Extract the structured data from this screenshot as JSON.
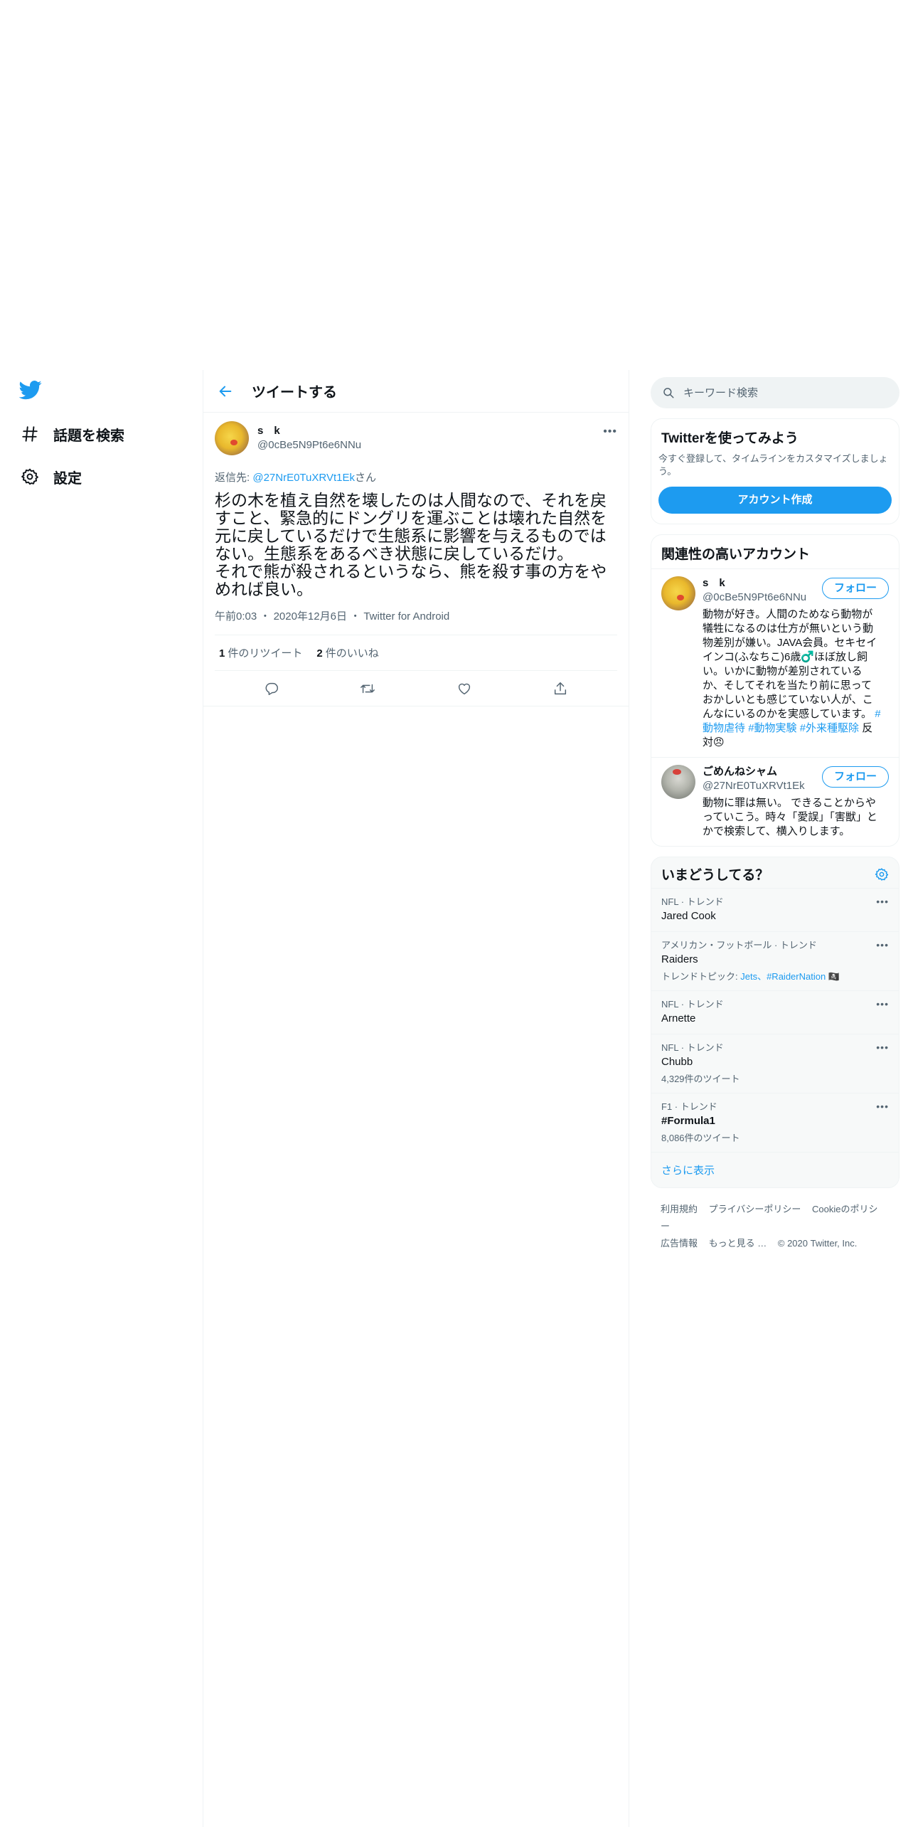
{
  "nav": {
    "items": [
      {
        "label": "話題を検索",
        "icon": "hashtag-icon"
      },
      {
        "label": "設定",
        "icon": "gear-icon"
      }
    ]
  },
  "header": {
    "title": "ツイートする"
  },
  "tweet": {
    "author_name": "s　k",
    "author_handle": "@0cBe5N9Pt6e6NNu",
    "replying_prefix": "返信先: ",
    "replying_to": "@27NrE0TuXRVt1Ek",
    "replying_suffix": "さん",
    "text": "杉の木を植え自然を壊したのは人間なので、それを戻すこと、緊急的にドングリを運ぶことは壊れた自然を元に戻しているだけで生態系に影響を与えるものではない。生態系をあるべき状態に戻しているだけ。\nそれで熊が殺されるというなら、熊を殺す事の方をやめれば良い。",
    "time": "午前0:03",
    "date": "2020年12月6日",
    "source": "Twitter for Android",
    "retweet_count": "1",
    "retweet_label": "件のリツイート",
    "like_count": "2",
    "like_label": "件のいいね"
  },
  "search": {
    "placeholder": "キーワード検索"
  },
  "signup": {
    "title": "Twitterを使ってみよう",
    "subtitle": "今すぐ登録して、タイムラインをカスタマイズしましょう。",
    "button": "アカウント作成"
  },
  "relevant": {
    "title": "関連性の高いアカウント",
    "follow_label": "フォロー",
    "accounts": [
      {
        "name": "s　k",
        "handle": "@0cBe5N9Pt6e6NNu",
        "bio": "動物が好き。人間のためなら動物が犠牲になるのは仕方が無いという動物差別が嫌い。JAVA会員。セキセイインコ(ふなちこ)6歳♂️ほぼ放し飼い。いかに動物が差別されているか、そしてそれを当たり前に思っておかしいとも感じていない人が、こんなにいるのかを実感しています。",
        "tags": [
          "#動物虐待",
          "#動物実験",
          "#外来種駆除"
        ],
        "bio_tail": "反対😠"
      },
      {
        "name": "ごめんねシャム",
        "handle": "@27NrE0TuXRVt1Ek",
        "bio": "動物に罪は無い。 できることからやっていこう。時々「愛誤」「害獣」とかで検索して、横入りします。"
      }
    ]
  },
  "trends": {
    "title": "いまどうしてる？",
    "items": [
      {
        "context": "NFL · トレンド",
        "name": "Jared Cook"
      },
      {
        "context": "アメリカン・フットボール · トレンド",
        "name": "Raiders",
        "sub_prefix": "トレンドトピック: ",
        "sub_tags": "Jets、#RaiderNation"
      },
      {
        "context": "NFL · トレンド",
        "name": "Arnette"
      },
      {
        "context": "NFL · トレンド",
        "name": "Chubb",
        "count": "4,329件のツイート"
      },
      {
        "context": "F1 · トレンド",
        "name": "#Formula1",
        "count": "8,086件のツイート"
      }
    ],
    "show_more": "さらに表示"
  },
  "footer": {
    "links": [
      "利用規約",
      "プライバシーポリシー",
      "Cookieのポリシー",
      "広告情報",
      "もっと見る …"
    ],
    "copyright": "© 2020 Twitter, Inc."
  },
  "colors": {
    "accent": "#1d9bf0",
    "text": "#0f1419",
    "muted": "#536471",
    "border": "#eff3f4"
  }
}
